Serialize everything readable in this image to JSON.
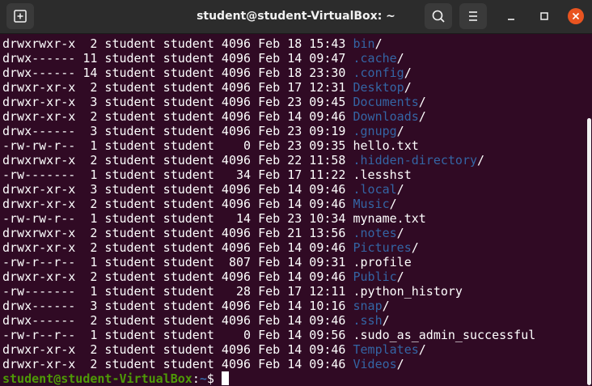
{
  "titlebar": {
    "title": "student@student-VirtualBox: ~",
    "icons": {
      "new_tab": "new-tab-icon",
      "search": "search-icon",
      "menu": "hamburger-menu-icon",
      "minimize": "minimize-icon",
      "maximize": "maximize-icon",
      "close": "close-icon"
    },
    "close_color": "#e95420"
  },
  "terminal": {
    "colors": {
      "background": "#300a24",
      "text": "#ffffff",
      "directory": "#3465a4",
      "prompt_user": "#4e9a06"
    },
    "entries": [
      {
        "perm": "drwxrwxr-x",
        "links": "2",
        "owner": "student",
        "group": "student",
        "size": "4096",
        "month": "Feb",
        "day": "18",
        "time": "15:43",
        "name": "bin",
        "is_dir": true
      },
      {
        "perm": "drwx------",
        "links": "11",
        "owner": "student",
        "group": "student",
        "size": "4096",
        "month": "Feb",
        "day": "14",
        "time": "09:47",
        "name": ".cache",
        "is_dir": true
      },
      {
        "perm": "drwx------",
        "links": "14",
        "owner": "student",
        "group": "student",
        "size": "4096",
        "month": "Feb",
        "day": "18",
        "time": "23:30",
        "name": ".config",
        "is_dir": true
      },
      {
        "perm": "drwxr-xr-x",
        "links": "2",
        "owner": "student",
        "group": "student",
        "size": "4096",
        "month": "Feb",
        "day": "17",
        "time": "12:31",
        "name": "Desktop",
        "is_dir": true
      },
      {
        "perm": "drwxr-xr-x",
        "links": "3",
        "owner": "student",
        "group": "student",
        "size": "4096",
        "month": "Feb",
        "day": "23",
        "time": "09:45",
        "name": "Documents",
        "is_dir": true
      },
      {
        "perm": "drwxr-xr-x",
        "links": "2",
        "owner": "student",
        "group": "student",
        "size": "4096",
        "month": "Feb",
        "day": "14",
        "time": "09:46",
        "name": "Downloads",
        "is_dir": true
      },
      {
        "perm": "drwx------",
        "links": "3",
        "owner": "student",
        "group": "student",
        "size": "4096",
        "month": "Feb",
        "day": "23",
        "time": "09:19",
        "name": ".gnupg",
        "is_dir": true
      },
      {
        "perm": "-rw-rw-r--",
        "links": "1",
        "owner": "student",
        "group": "student",
        "size": "0",
        "month": "Feb",
        "day": "23",
        "time": "09:35",
        "name": "hello.txt",
        "is_dir": false
      },
      {
        "perm": "drwxrwxr-x",
        "links": "2",
        "owner": "student",
        "group": "student",
        "size": "4096",
        "month": "Feb",
        "day": "22",
        "time": "11:58",
        "name": ".hidden-directory",
        "is_dir": true
      },
      {
        "perm": "-rw-------",
        "links": "1",
        "owner": "student",
        "group": "student",
        "size": "34",
        "month": "Feb",
        "day": "17",
        "time": "11:22",
        "name": ".lesshst",
        "is_dir": false
      },
      {
        "perm": "drwxr-xr-x",
        "links": "3",
        "owner": "student",
        "group": "student",
        "size": "4096",
        "month": "Feb",
        "day": "14",
        "time": "09:46",
        "name": ".local",
        "is_dir": true
      },
      {
        "perm": "drwxr-xr-x",
        "links": "2",
        "owner": "student",
        "group": "student",
        "size": "4096",
        "month": "Feb",
        "day": "14",
        "time": "09:46",
        "name": "Music",
        "is_dir": true
      },
      {
        "perm": "-rw-rw-r--",
        "links": "1",
        "owner": "student",
        "group": "student",
        "size": "14",
        "month": "Feb",
        "day": "23",
        "time": "10:34",
        "name": "myname.txt",
        "is_dir": false
      },
      {
        "perm": "drwxrwxr-x",
        "links": "2",
        "owner": "student",
        "group": "student",
        "size": "4096",
        "month": "Feb",
        "day": "21",
        "time": "13:56",
        "name": ".notes",
        "is_dir": true
      },
      {
        "perm": "drwxr-xr-x",
        "links": "2",
        "owner": "student",
        "group": "student",
        "size": "4096",
        "month": "Feb",
        "day": "14",
        "time": "09:46",
        "name": "Pictures",
        "is_dir": true
      },
      {
        "perm": "-rw-r--r--",
        "links": "1",
        "owner": "student",
        "group": "student",
        "size": "807",
        "month": "Feb",
        "day": "14",
        "time": "09:31",
        "name": ".profile",
        "is_dir": false
      },
      {
        "perm": "drwxr-xr-x",
        "links": "2",
        "owner": "student",
        "group": "student",
        "size": "4096",
        "month": "Feb",
        "day": "14",
        "time": "09:46",
        "name": "Public",
        "is_dir": true
      },
      {
        "perm": "-rw-------",
        "links": "1",
        "owner": "student",
        "group": "student",
        "size": "28",
        "month": "Feb",
        "day": "17",
        "time": "12:11",
        "name": ".python_history",
        "is_dir": false
      },
      {
        "perm": "drwx------",
        "links": "3",
        "owner": "student",
        "group": "student",
        "size": "4096",
        "month": "Feb",
        "day": "14",
        "time": "10:16",
        "name": "snap",
        "is_dir": true
      },
      {
        "perm": "drwx------",
        "links": "2",
        "owner": "student",
        "group": "student",
        "size": "4096",
        "month": "Feb",
        "day": "14",
        "time": "09:46",
        "name": ".ssh",
        "is_dir": true
      },
      {
        "perm": "-rw-r--r--",
        "links": "1",
        "owner": "student",
        "group": "student",
        "size": "0",
        "month": "Feb",
        "day": "14",
        "time": "09:56",
        "name": ".sudo_as_admin_successful",
        "is_dir": false
      },
      {
        "perm": "drwxr-xr-x",
        "links": "2",
        "owner": "student",
        "group": "student",
        "size": "4096",
        "month": "Feb",
        "day": "14",
        "time": "09:46",
        "name": "Templates",
        "is_dir": true
      },
      {
        "perm": "drwxr-xr-x",
        "links": "2",
        "owner": "student",
        "group": "student",
        "size": "4096",
        "month": "Feb",
        "day": "14",
        "time": "09:46",
        "name": "Videos",
        "is_dir": true
      }
    ],
    "prompt": {
      "user_host": "student@student-VirtualBox",
      "separator": ":",
      "path": "~",
      "symbol": "$ "
    }
  }
}
